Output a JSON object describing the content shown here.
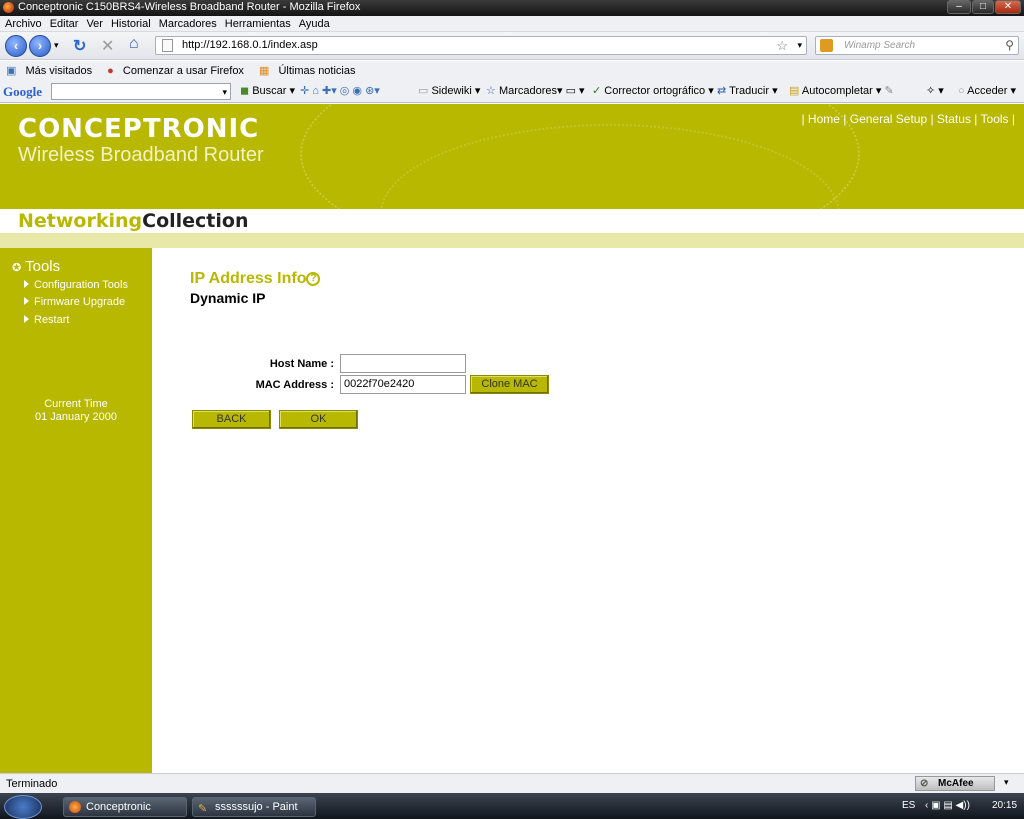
{
  "window": {
    "title": "Conceptronic C150BRS4-Wireless Broadband Router - Mozilla Firefox"
  },
  "menu": [
    "Archivo",
    "Editar",
    "Ver",
    "Historial",
    "Marcadores",
    "Herramientas",
    "Ayuda"
  ],
  "nav": {
    "url": "http://192.168.0.1/index.asp",
    "search_placeholder": "Winamp Search"
  },
  "bookmarks": [
    "Más visitados",
    "Comenzar a usar Firefox",
    "Últimas noticias"
  ],
  "google_toolbar": {
    "logo": "Google",
    "items": [
      "Buscar",
      "Sidewiki",
      "Marcadores",
      "Corrector ortográfico",
      "Traducir",
      "Autocompletar",
      "Acceder"
    ]
  },
  "page": {
    "brand": "CONCEPTRONIC",
    "brand_sub": "Wireless Broadband Router",
    "top_nav": [
      "Home",
      "General Setup",
      "Status",
      "Tools"
    ],
    "collection_a": "Networking",
    "collection_b": "Collection",
    "sidebar": {
      "title": "Tools",
      "items": [
        "Configuration Tools",
        "Firmware Upgrade",
        "Restart"
      ],
      "time_label": "Current Time",
      "time_value": "01 January 2000"
    },
    "section_title": "IP Address Info",
    "section_sub": "Dynamic IP",
    "form": {
      "host_label": "Host Name :",
      "host_value": "",
      "mac_label": "MAC Address :",
      "mac_value": "0022f70e2420",
      "clone_label": "Clone MAC",
      "back_label": "BACK",
      "ok_label": "OK"
    }
  },
  "status": {
    "text": "Terminado",
    "mcafee": "McAfee"
  },
  "taskbar": {
    "tasks": [
      "Conceptronic C150...",
      "ssssssujo - Paint"
    ],
    "lang": "ES",
    "clock": "20:15"
  },
  "colors": {
    "brand": "#b8b800",
    "stripe": "#e8e8a8"
  }
}
